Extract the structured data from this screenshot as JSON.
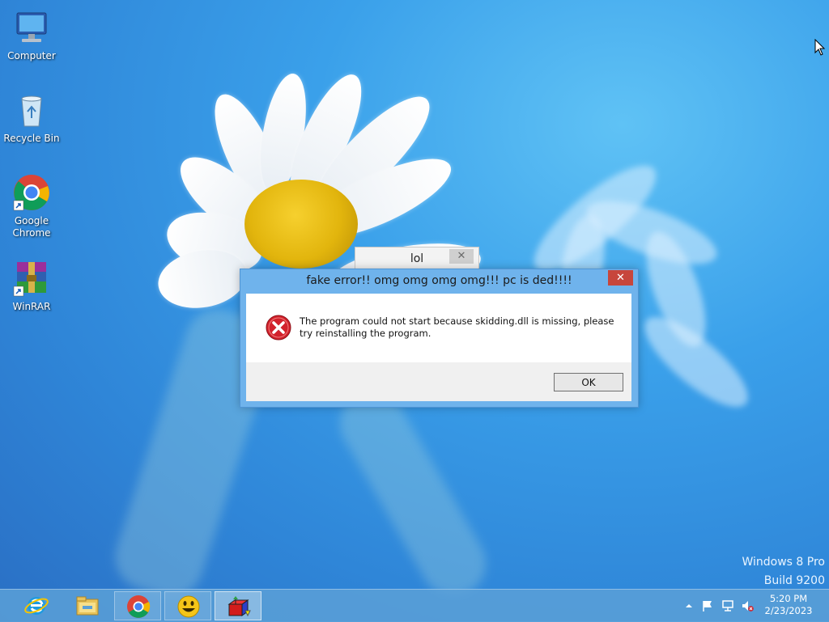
{
  "desktop": {
    "icons": [
      {
        "label": "Computer",
        "icon": "computer-icon"
      },
      {
        "label": "Recycle Bin",
        "icon": "recycle-bin-icon"
      },
      {
        "label": "Google Chrome",
        "icon": "chrome-icon"
      },
      {
        "label": "WinRAR",
        "icon": "winrar-icon"
      }
    ]
  },
  "windows": {
    "back": {
      "title": "lol",
      "close": "✕"
    },
    "error_dialog": {
      "title": "fake error!! omg omg omg omg!!! pc is ded!!!!",
      "close": "✕",
      "message": "The program could not start because skidding.dll is missing, please try reinstalling the program.",
      "ok_label": "OK"
    }
  },
  "watermark": {
    "line1": "Windows 8 Pro",
    "line2": "Build 9200"
  },
  "taskbar": {
    "buttons": [
      {
        "app": "internet-explorer-icon"
      },
      {
        "app": "file-explorer-icon"
      },
      {
        "app": "chrome-icon"
      },
      {
        "app": "smiley-app-icon"
      },
      {
        "app": "cube-app-icon"
      }
    ],
    "tray": {
      "icons": [
        "show-hidden-icons-icon",
        "action-center-flag-icon",
        "network-icon",
        "volume-muted-icon"
      ],
      "time": "5:20 PM",
      "date": "2/23/2023"
    }
  },
  "colors": {
    "title_bar": "#6fb3ec",
    "close_button": "#c7463c",
    "taskbar": "#5aa0d7",
    "error_red": "#d2222c"
  }
}
